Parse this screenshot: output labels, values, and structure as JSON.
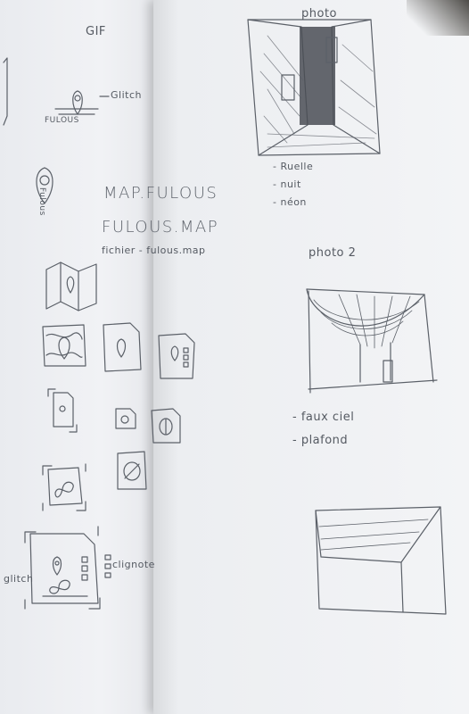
{
  "left_page": {
    "gif_label": "GIF",
    "glitch_label": "Glitch",
    "fulous_small": "FULOUS",
    "fulous_vertical": "Fulous",
    "map_fulous": "MAP.FULOUS",
    "fulous_map": "FULOUS.MAP",
    "fichier_label": "fichier - fulous.map",
    "glitch_bottom": "glitch",
    "clignote_label": "clignote"
  },
  "right_page": {
    "photo_label": "photo",
    "photo1_notes": [
      "- Ruelle",
      "- nuit",
      "- néon"
    ],
    "photo2_label": "photo 2",
    "photo2_notes": [
      "- faux ciel",
      "- plafond"
    ]
  }
}
